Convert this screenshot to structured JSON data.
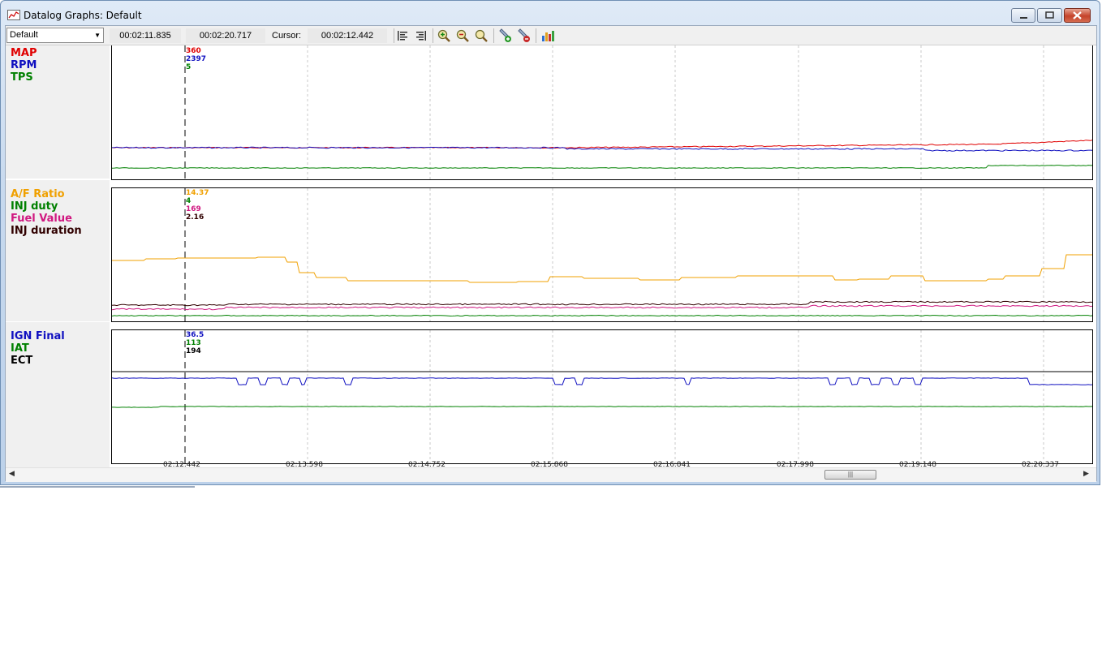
{
  "window": {
    "title": "Datalog Graphs: Default"
  },
  "toolbar": {
    "profile_select": "Default",
    "start_time": "00:02:11.835",
    "end_time": "00:02:20.717",
    "cursor_label": "Cursor:",
    "cursor_time": "00:02:12.442",
    "icons": [
      "align-left-icon",
      "align-right-icon",
      "zoom-in-icon",
      "zoom-out-icon",
      "zoom-fit-icon",
      "pin-add-icon",
      "pin-remove-icon",
      "chart-settings-icon"
    ]
  },
  "colors": {
    "map": "#e00000",
    "rpm": "#1010c0",
    "tps": "#008000",
    "afr": "#f0a000",
    "inj_duty": "#008000",
    "fuel_value": "#d01880",
    "inj_duration": "#300000",
    "ign_final": "#1010c0",
    "iat": "#008000",
    "ect": "#000000"
  },
  "panels": [
    {
      "channels": [
        {
          "name": "MAP",
          "value": "360",
          "color": "#e00000"
        },
        {
          "name": "RPM",
          "value": "2397",
          "color": "#1010c0"
        },
        {
          "name": "TPS",
          "value": "5",
          "color": "#008000"
        }
      ]
    },
    {
      "channels": [
        {
          "name": "A/F Ratio",
          "value": "14.37",
          "color": "#f0a000"
        },
        {
          "name": "INJ duty",
          "value": "4",
          "color": "#008000"
        },
        {
          "name": "Fuel Value",
          "value": "169",
          "color": "#d01880"
        },
        {
          "name": "INJ duration",
          "value": "2.16",
          "color": "#300000"
        }
      ]
    },
    {
      "channels": [
        {
          "name": "IGN Final",
          "value": "36.5",
          "color": "#1010c0"
        },
        {
          "name": "IAT",
          "value": "113",
          "color": "#008000"
        },
        {
          "name": "ECT",
          "value": "194",
          "color": "#000000"
        }
      ]
    }
  ],
  "x_axis_ticks": [
    "02:12.442",
    "02:13.598",
    "02:14.752",
    "02:15.868",
    "02:16.841",
    "02:17.998",
    "02:19.148",
    "02:20.337"
  ]
}
